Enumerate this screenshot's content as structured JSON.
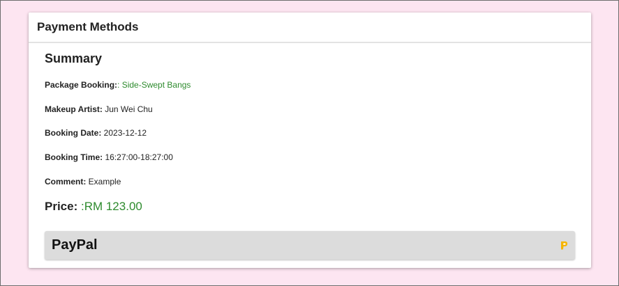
{
  "card": {
    "title": "Payment Methods"
  },
  "summary": {
    "heading": "Summary",
    "package_label": "Package Booking:",
    "package_value": ": Side-Swept Bangs",
    "artist_label": "Makeup Artist:",
    "artist_value": " Jun Wei Chu",
    "date_label": "Booking Date:",
    "date_value": " 2023-12-12",
    "time_label": "Booking Time:",
    "time_value": " 16:27:00-18:27:00",
    "comment_label": "Comment:",
    "comment_value": " Example"
  },
  "price": {
    "label": "Price:",
    "value": " :RM 123.00"
  },
  "payment": {
    "paypal_label": "PayPal",
    "icon": "paypal-icon",
    "accent": "#f5b400"
  },
  "colors": {
    "background": "#fde5f1",
    "green": "#2e8b2e"
  }
}
